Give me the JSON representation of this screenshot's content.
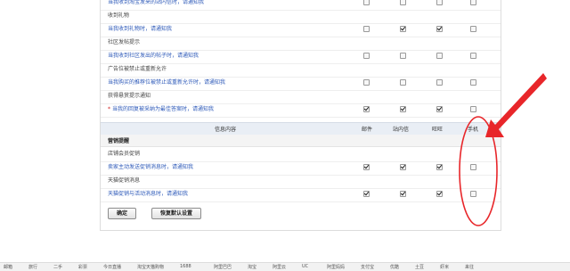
{
  "rows_top": [
    {
      "text": "当我收到淘宝发来的站内信时，请通知我",
      "type": "link",
      "checks": [
        false,
        false,
        false,
        false
      ]
    },
    {
      "text": "收到礼物",
      "type": "plain",
      "checks": null
    },
    {
      "text": "当我收到礼物时，请通知我",
      "type": "link",
      "checks": [
        false,
        true,
        true,
        false
      ]
    },
    {
      "text": "社区发帖提示",
      "type": "plain",
      "checks": null
    },
    {
      "text": "当我收到社区发出的帖子时，请通知我",
      "type": "link",
      "checks": [
        false,
        false,
        false,
        false
      ]
    },
    {
      "text": "广告位被禁止或重新允许",
      "type": "plain",
      "checks": null
    },
    {
      "text": "当我购买的推荐位被禁止或重新允许时，请通知我",
      "type": "link",
      "checks": [
        false,
        false,
        false,
        false
      ]
    },
    {
      "text": "获得悬赏提示通知",
      "type": "plain",
      "checks": null
    },
    {
      "text": "当我的回复被采纳为最佳答案时，请通知我",
      "type": "urgent",
      "required_mark": "*",
      "checks": [
        true,
        true,
        true,
        false
      ]
    }
  ],
  "header": {
    "info": "信息内容",
    "email": "邮件",
    "station": "站内信",
    "wangwang": "旺旺",
    "mobile": "手机"
  },
  "section": {
    "title": "营销提醒"
  },
  "rows_bottom": [
    {
      "text": "店铺会员促销",
      "type": "plain",
      "checks": null
    },
    {
      "text": "卖家主动发送促销消息时，请通知我",
      "type": "link",
      "checks": [
        true,
        true,
        true,
        false
      ]
    },
    {
      "text": "天猫促销消息",
      "type": "plain",
      "checks": null
    },
    {
      "text": "天猫促销与活动消息时，请通知我",
      "type": "link",
      "checks": [
        true,
        true,
        true,
        false
      ]
    }
  ],
  "buttons": {
    "confirm": "确定",
    "restore": "恢复默认设置"
  },
  "annotation": {
    "color": "#e8262a"
  },
  "taskbar_items": [
    "邮箱",
    "旅行",
    "二手",
    "彩票",
    "今日直播",
    "淘宝天猫购物",
    "1688",
    "阿里巴巴",
    "淘宝",
    "阿里云",
    "UC",
    "阿里妈妈",
    "支付宝",
    "优酷",
    "土豆",
    "虾米",
    "来往"
  ]
}
